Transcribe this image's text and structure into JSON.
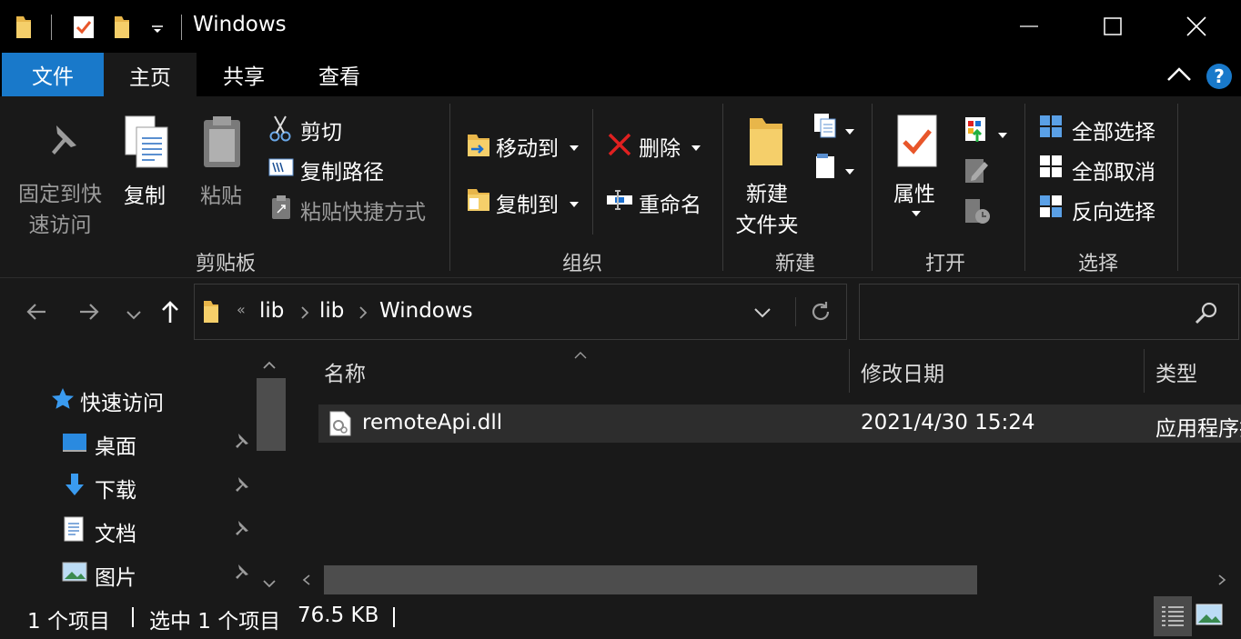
{
  "window": {
    "title": "Windows"
  },
  "tabs": {
    "file": "文件",
    "home": "主页",
    "share": "共享",
    "view": "查看"
  },
  "ribbon": {
    "clipboard": {
      "pin": "固定到快",
      "pin2": "速访问",
      "copy": "复制",
      "paste": "粘贴",
      "cut": "剪切",
      "copy_path": "复制路径",
      "paste_shortcut": "粘贴快捷方式",
      "label": "剪贴板"
    },
    "organize": {
      "move_to": "移动到",
      "copy_to": "复制到",
      "delete": "删除",
      "rename": "重命名",
      "label": "组织"
    },
    "new": {
      "new_folder": "新建",
      "new_folder2": "文件夹",
      "label": "新建"
    },
    "open": {
      "properties": "属性",
      "label": "打开"
    },
    "select": {
      "select_all": "全部选择",
      "select_none": "全部取消",
      "invert": "反向选择",
      "label": "选择"
    }
  },
  "address": {
    "crumbs": [
      "lib",
      "lib",
      "Windows"
    ],
    "overflow": "«"
  },
  "nav": {
    "quick_access": "快速访问",
    "items": [
      {
        "label": "桌面"
      },
      {
        "label": "下载"
      },
      {
        "label": "文档"
      },
      {
        "label": "图片"
      }
    ]
  },
  "columns": {
    "name": "名称",
    "modified": "修改日期",
    "type": "类型"
  },
  "files": [
    {
      "name": "remoteApi.dll",
      "modified": "2021/4/30 15:24",
      "type": "应用程序扩"
    }
  ],
  "status": {
    "count": "1 个项目",
    "selected": "选中 1 个项目",
    "size": "76.5 KB"
  },
  "colors": {
    "accent": "#1979ca",
    "ribbon_bg": "#191919",
    "window_bg": "#000000"
  }
}
